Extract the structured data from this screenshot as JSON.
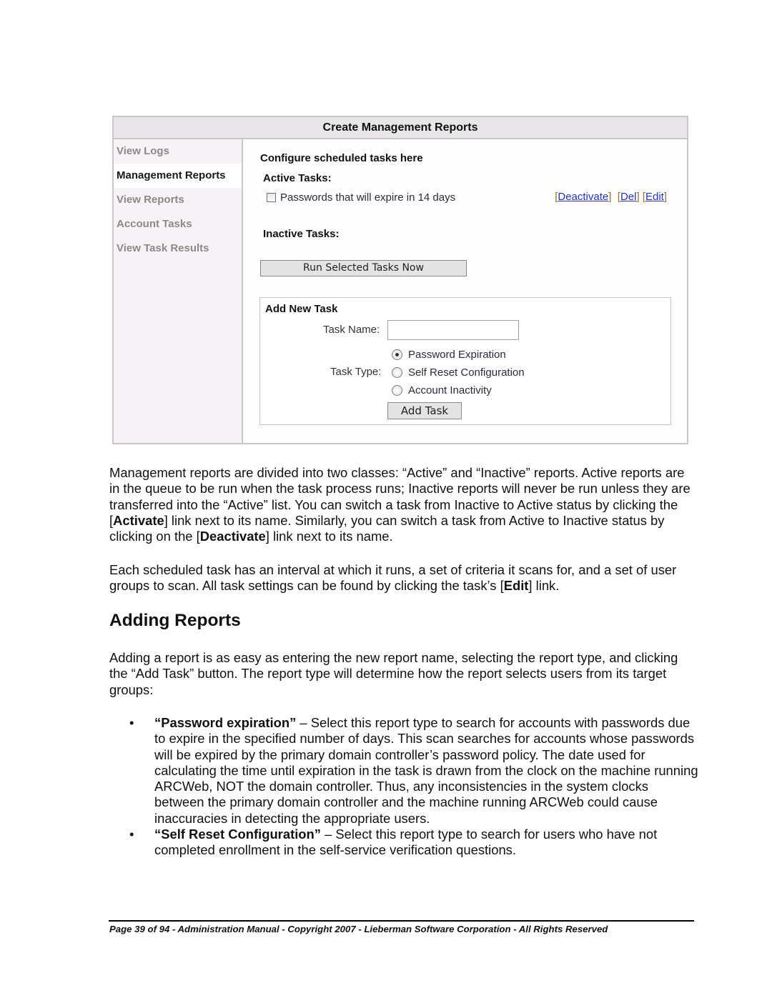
{
  "app": {
    "title": "Create Management Reports",
    "sidebar": {
      "items": [
        {
          "label": "View Logs",
          "active": false
        },
        {
          "label": "Management Reports",
          "active": true
        },
        {
          "label": "View Reports",
          "active": false
        },
        {
          "label": "Account Tasks",
          "active": false
        },
        {
          "label": "View Task Results",
          "active": false
        }
      ]
    },
    "main": {
      "intro": "Configure scheduled tasks here",
      "active_heading": "Active Tasks:",
      "active_tasks": [
        {
          "label": "Passwords that will expire in 14 days",
          "checked": false,
          "links": {
            "deactivate": "Deactivate",
            "del": "Del",
            "edit": "Edit"
          }
        }
      ],
      "inactive_heading": "Inactive Tasks:",
      "run_button": "Run Selected Tasks Now",
      "add_task": {
        "heading": "Add New Task",
        "name_label": "Task Name:",
        "name_value": "",
        "type_label": "Task Type:",
        "types": [
          {
            "label": "Password Expiration",
            "selected": true
          },
          {
            "label": "Self Reset Configuration",
            "selected": false
          },
          {
            "label": "Account Inactivity",
            "selected": false
          }
        ],
        "add_button": "Add Task"
      }
    }
  },
  "doc": {
    "para1": {
      "part1": "Management reports are divided into two classes: “Active” and “Inactive” reports.  Active reports are in the queue to be run when the task process runs; Inactive reports will never be run unless they are transferred into the “Active” list.  You can switch a task from Inactive to Active status by clicking the [",
      "bold1": "Activate",
      "part2": "] link next to its name.  Similarly, you can switch a task from Active to Inactive status by clicking on the [",
      "bold2": "Deactivate",
      "part3": "] link next to its name."
    },
    "para2": {
      "part1": "Each scheduled task has an interval at which it runs, a set of criteria it scans for, and a set of user groups to scan.  All task settings can be found by clicking the task’s [",
      "bold1": "Edit",
      "part2": "] link."
    },
    "heading": "Adding Reports",
    "para3": "Adding a report is as easy as entering the new report name, selecting the report type, and clicking the “Add Task” button.  The report type will determine how the report selects users from its target groups:",
    "bullets": [
      {
        "bullet": "•",
        "term": " “Password expiration”",
        "text": " – Select this report type to search for accounts with passwords due to expire in the specified number of days.  This scan searches for accounts whose passwords will be expired by the primary domain controller’s password policy.  The date used for calculating the time until expiration in the task is drawn from the clock on the machine running ARCWeb, NOT the domain controller.  Thus, any inconsistencies in the system clocks between the primary domain controller and the machine running ARCWeb could cause inaccuracies in detecting the appropriate users."
      },
      {
        "bullet": "•",
        "term": "“Self Reset Configuration”",
        "text": " – Select this report type to search for users who have not completed enrollment in the self-service verification questions."
      }
    ],
    "footer": "Page 39 of 94 - Administration Manual - Copyright 2007 - Lieberman Software Corporation - All Rights Reserved"
  }
}
